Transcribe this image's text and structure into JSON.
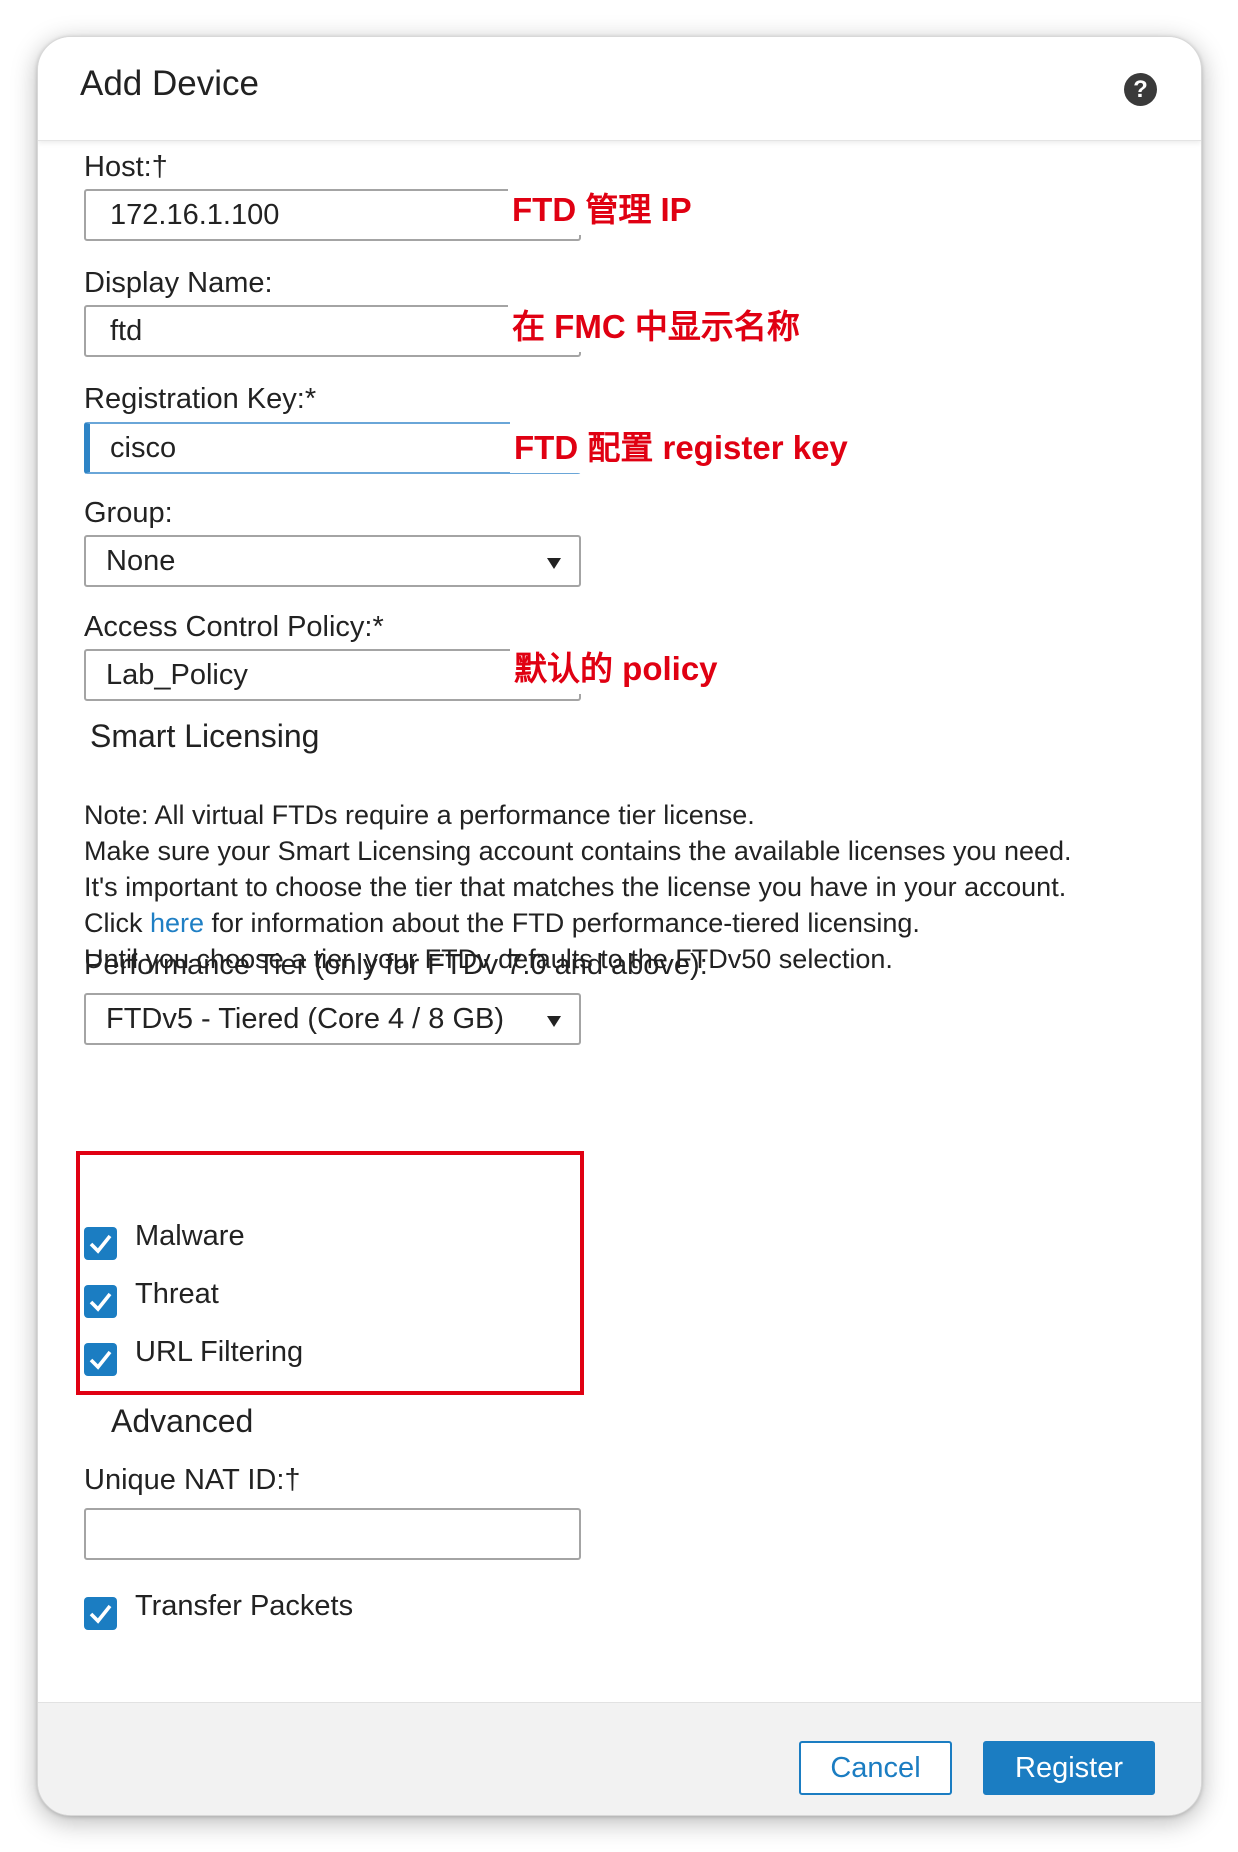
{
  "dialog": {
    "title": "Add Device"
  },
  "host": {
    "label": "Host:†",
    "value": "172.16.1.100",
    "annotation": "FTD 管理 IP"
  },
  "display_name": {
    "label": "Display Name:",
    "value": "ftd",
    "annotation": "在 FMC 中显示名称"
  },
  "registration_key": {
    "label": "Registration Key:*",
    "value": "cisco",
    "annotation": "FTD 配置 register key"
  },
  "group": {
    "label": "Group:",
    "selected": "None"
  },
  "access_control_policy": {
    "label": "Access Control Policy:*",
    "selected": "Lab_Policy",
    "annotation": "默认的 policy"
  },
  "smart_licensing": {
    "title": "Smart Licensing",
    "note_lines": [
      "Note: All virtual FTDs require a performance tier license.",
      "Make sure your Smart Licensing account contains the available licenses you need.",
      "It's important to choose the tier that matches the license you have in your account."
    ],
    "click_prefix": "Click ",
    "click_link": "here",
    "click_suffix": " for information about the FTD performance-tiered licensing.",
    "until_line": "Until you choose a tier, your FTDv defaults to the FTDv50 selection."
  },
  "performance_tier": {
    "label": "Performance Tier (only for FTDv 7.0 and above):",
    "selected": "FTDv5 - Tiered (Core 4 / 8 GB)",
    "licenses": [
      {
        "label": "Malware",
        "checked": true
      },
      {
        "label": "Threat",
        "checked": true
      },
      {
        "label": "URL Filtering",
        "checked": true
      }
    ]
  },
  "advanced": {
    "title": "Advanced",
    "unique_nat_id": {
      "label": "Unique NAT ID:†",
      "value": ""
    },
    "transfer_packets": {
      "label": "Transfer Packets",
      "checked": true
    }
  },
  "footer": {
    "cancel_label": "Cancel",
    "register_label": "Register"
  },
  "colors": {
    "accent": "#1b7dc2",
    "annotation": "#e00012"
  },
  "icons": {
    "help": "help-icon",
    "password_toggle": "eye-slash-icon",
    "dropdown": "chevron-down-icon",
    "checkbox": "checkmark-icon"
  }
}
